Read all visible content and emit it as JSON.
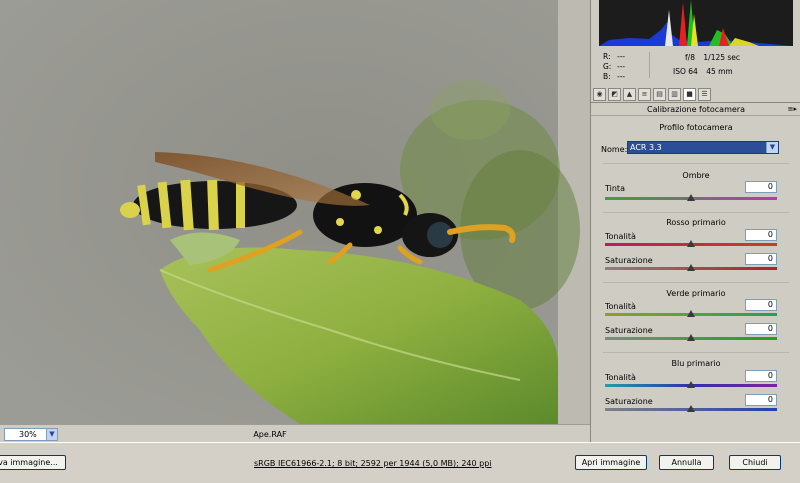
{
  "preview": {
    "zoom_value": "30%",
    "filename": "Ape.RAF"
  },
  "readout": {
    "r_label": "R:",
    "r_value": "---",
    "g_label": "G:",
    "g_value": "---",
    "b_label": "B:",
    "b_value": "---",
    "aperture": "f/8",
    "shutter": "1/125 sec",
    "iso": "ISO 64",
    "focal": "45 mm"
  },
  "tabs": [
    {
      "icon": "basic-icon"
    },
    {
      "icon": "tone-curve-icon"
    },
    {
      "icon": "detail-icon"
    },
    {
      "icon": "hsl-icon"
    },
    {
      "icon": "split-toning-icon"
    },
    {
      "icon": "lens-icon"
    },
    {
      "icon": "camera-calibration-icon"
    },
    {
      "icon": "presets-icon"
    }
  ],
  "panel": {
    "title": "Calibrazione fotocamera",
    "profile_heading": "Profilo fotocamera",
    "name_label": "Nome:",
    "name_value": "ACR 3.3",
    "sections": [
      {
        "heading": "Ombre",
        "fields": [
          {
            "label": "Tinta",
            "value": "0",
            "level": 0
          }
        ]
      },
      {
        "heading": "Rosso primario",
        "fields": [
          {
            "label": "Tonalità",
            "value": "0",
            "level": 0
          },
          {
            "label": "Saturazione",
            "value": "0",
            "level": 0
          }
        ]
      },
      {
        "heading": "Verde primario",
        "fields": [
          {
            "label": "Tonalità",
            "value": "0",
            "level": 0
          },
          {
            "label": "Saturazione",
            "value": "0",
            "level": 0
          }
        ]
      },
      {
        "heading": "Blu primario",
        "fields": [
          {
            "label": "Tonalità",
            "value": "0",
            "level": 0
          },
          {
            "label": "Saturazione",
            "value": "0",
            "level": 0
          }
        ]
      }
    ]
  },
  "bottom": {
    "save_label": "va immagine...",
    "info_link": "sRGB IEC61966-2.1; 8 bit; 2592 per 1944 (5,0 MB); 240 ppi",
    "open_label": "Apri immagine",
    "cancel_label": "Annulla",
    "close_label": "Chiudi"
  }
}
